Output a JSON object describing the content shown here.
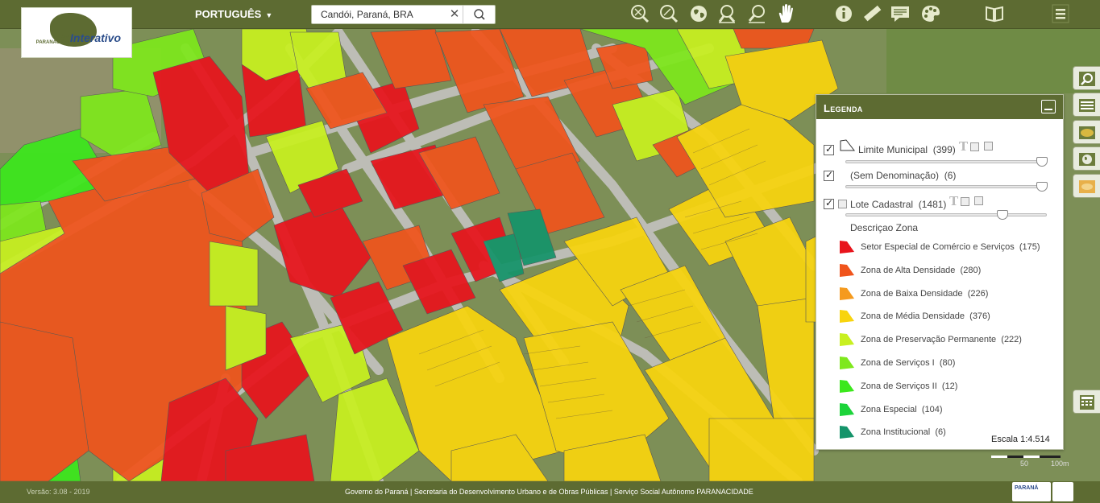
{
  "header": {
    "logo_text_small": "SEDU PARANACIDADE",
    "logo_text_main": "Interativo",
    "language": "PORTUGUÊS",
    "search_value": "Candói, Paraná, BRA",
    "tools": [
      "zoom-extent-icon",
      "zoom-in-area-icon",
      "globe-icon",
      "zoom-in-icon",
      "zoom-out-icon",
      "pan-hand-icon",
      "info-icon",
      "ruler-icon",
      "comment-icon",
      "palette-icon",
      "book-icon",
      "menu-icon"
    ]
  },
  "sidebar_right": [
    "search-map-icon",
    "list-icon",
    "layers-icon",
    "world-map-icon",
    "basemap-icon",
    "calculator-icon"
  ],
  "legend": {
    "title": "Legenda",
    "layers": [
      {
        "label": "Limite Municipal",
        "count": "(399)",
        "checked": true
      },
      {
        "label": "(Sem Denominação)",
        "count": "(6)",
        "checked": true
      },
      {
        "label": "Lote Cadastral",
        "count": "(1481)",
        "checked": true
      }
    ],
    "subtitle": "Descriçao Zona",
    "zones": [
      {
        "label": "Setor Especial de Comércio e Serviços",
        "count": "(175)",
        "color": "#e8141c"
      },
      {
        "label": "Zona de Alta Densidade",
        "count": "(280)",
        "color": "#f0541c"
      },
      {
        "label": "Zona de Baixa Densidade",
        "count": "(226)",
        "color": "#f59a1e"
      },
      {
        "label": "Zona de Média Densidade",
        "count": "(376)",
        "color": "#f8d40e"
      },
      {
        "label": "Zona de Preservação Permanente",
        "count": "(222)",
        "color": "#c8f020"
      },
      {
        "label": "Zona de Serviços I",
        "count": "(80)",
        "color": "#7ee81c"
      },
      {
        "label": "Zona de Serviços II",
        "count": "(12)",
        "color": "#3ce81c"
      },
      {
        "label": "Zona Especial",
        "count": "(104)",
        "color": "#1cd43a"
      },
      {
        "label": "Zona Institucional",
        "count": "(6)",
        "color": "#15946a"
      }
    ],
    "scale": "Escala 1:4.514"
  },
  "scalebar": {
    "mid": "50",
    "end": "100m"
  },
  "footer": {
    "version": "Versão: 3.08 - 2019",
    "credits": "Governo do Paraná | Secretaria do Desenvolvimento Urbano e de Obras Públicas | Serviço Social Autônomo PARANACIDADE",
    "gov_logo": "PARANÁ"
  },
  "colors": {
    "bar": "#5d6b32",
    "red": "#e8141c",
    "orange": "#f0541c",
    "yellow": "#f8d40e",
    "lime": "#c8f020",
    "green": "#3ce81c",
    "teal": "#15946a"
  }
}
